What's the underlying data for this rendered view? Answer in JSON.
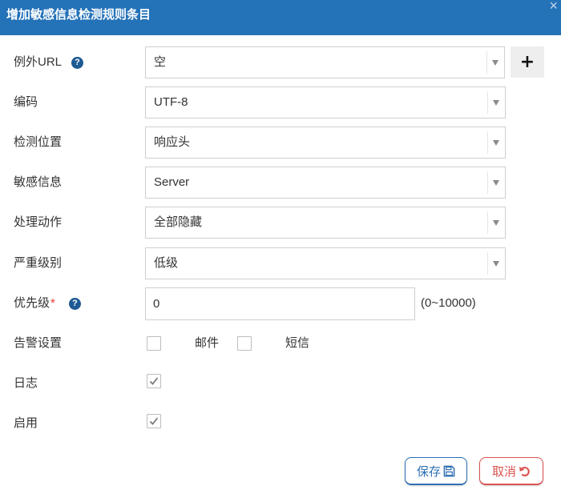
{
  "dialog": {
    "title": "增加敏感信息检测规则条目",
    "close_glyph": "×"
  },
  "help_glyph": "?",
  "form": {
    "exception_url": {
      "label": "例外URL",
      "value": "空",
      "add_glyph": "+"
    },
    "encoding": {
      "label": "编码",
      "value": "UTF-8"
    },
    "detect_position": {
      "label": "检测位置",
      "value": "响应头"
    },
    "sensitive_info": {
      "label": "敏感信息",
      "value": "Server"
    },
    "action": {
      "label": "处理动作",
      "value": "全部隐藏"
    },
    "severity": {
      "label": "严重级别",
      "value": "低级"
    },
    "priority": {
      "label": "优先级",
      "required_mark": "*",
      "value": "0",
      "hint": "(0~10000)"
    },
    "alert": {
      "label": "告警设置",
      "email_label": "邮件",
      "email_checked": false,
      "sms_label": "短信",
      "sms_checked": false
    },
    "log": {
      "label": "日志",
      "checked": true
    },
    "enable": {
      "label": "启用",
      "checked": true
    }
  },
  "buttons": {
    "save_label": "保存",
    "cancel_label": "取消"
  },
  "icons": {
    "close": "close-icon",
    "help": "help-icon",
    "dropdown": "chevron-down-icon",
    "add": "plus-icon",
    "check": "check-icon",
    "save": "save-icon",
    "cancel": "undo-icon"
  },
  "colors": {
    "title_bar": "#2472b8",
    "title_text": "#ffffff",
    "help_icon": "#1d5a93",
    "required": "#e53935",
    "save_accent": "#2f6fb3",
    "cancel_accent": "#d9534f",
    "border": "#cfcfcf",
    "text": "#333333"
  }
}
